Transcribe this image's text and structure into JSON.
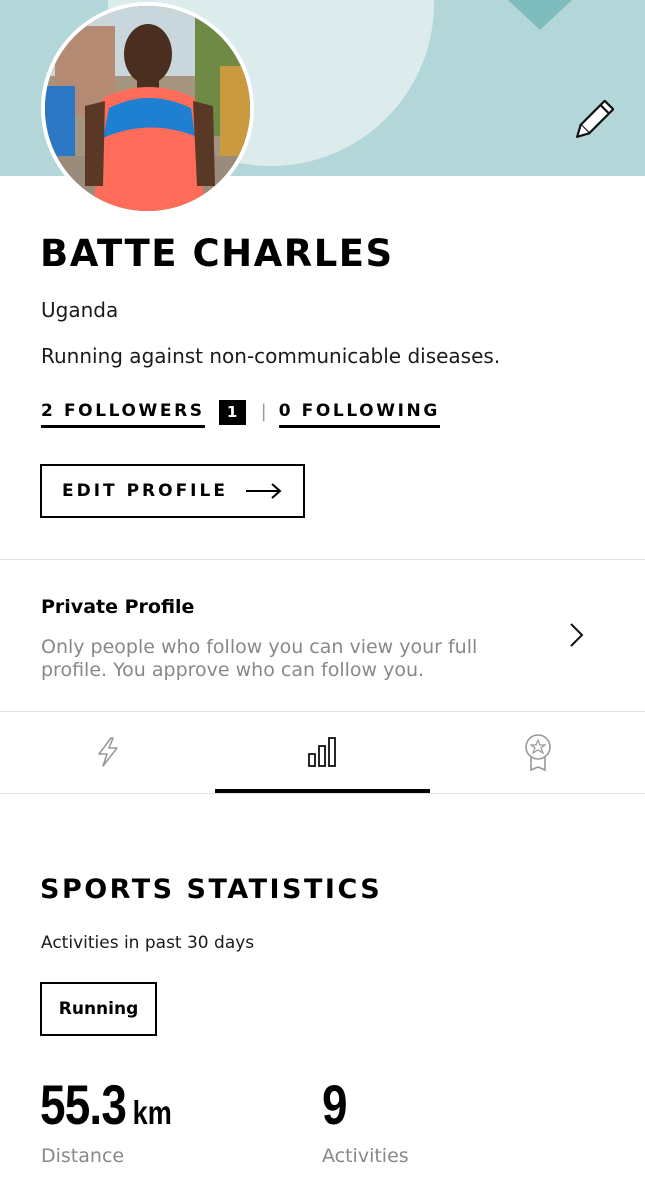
{
  "profile": {
    "name": "BATTE CHARLES",
    "country": "Uganda",
    "bio": "Running against non-communicable diseases.",
    "followers_label": "2 FOLLOWERS",
    "pending_requests_badge": "1",
    "following_label": "0 FOLLOWING",
    "edit_profile_label": "EDIT PROFILE"
  },
  "privacy": {
    "title": "Private Profile",
    "description": "Only people who follow you can view your full profile. You approve who can follow you."
  },
  "tabs": [
    {
      "icon": "lightning-icon",
      "selected": false
    },
    {
      "icon": "bar-chart-icon",
      "selected": true
    },
    {
      "icon": "medal-icon",
      "selected": false
    }
  ],
  "stats": {
    "title": "SPORTS STATISTICS",
    "subtitle": "Activities in past 30 days",
    "sport_filter": "Running",
    "distance_value": "55.3",
    "distance_unit": "km",
    "distance_label": "Distance",
    "activities_value": "9",
    "activities_label": "Activities"
  },
  "colors": {
    "header_background": "#b3d7d8",
    "header_circle": "#dcecec",
    "accent_triangle": "#7fbcbe",
    "muted_text": "#888888"
  }
}
